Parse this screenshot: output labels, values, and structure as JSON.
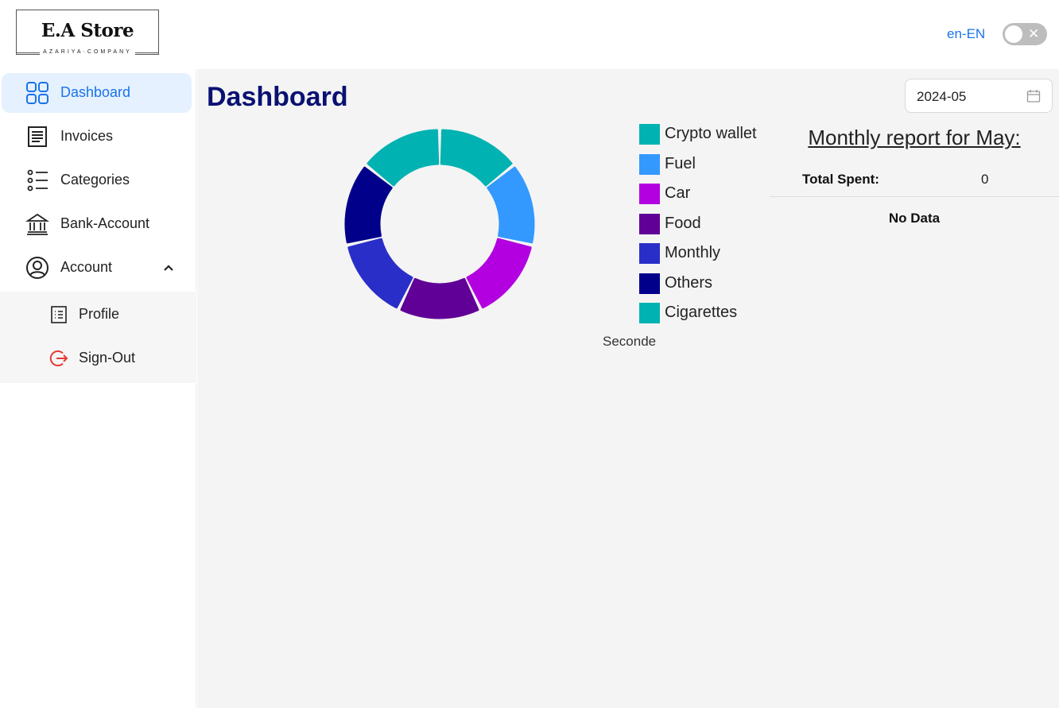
{
  "header": {
    "logo_title": "E.A Store",
    "logo_subtitle": "AZARIYA·COMPANY",
    "language": "en-EN",
    "toggle_state": "off"
  },
  "sidebar": {
    "items": [
      {
        "label": "Dashboard",
        "icon": "grid-icon",
        "active": true
      },
      {
        "label": "Invoices",
        "icon": "receipt-icon"
      },
      {
        "label": "Categories",
        "icon": "list-icon"
      },
      {
        "label": "Bank-Account",
        "icon": "bank-icon"
      },
      {
        "label": "Account",
        "icon": "user-circle-icon",
        "expanded": true
      }
    ],
    "sub_items": [
      {
        "label": "Profile",
        "icon": "profile-list-icon"
      },
      {
        "label": "Sign-Out",
        "icon": "sign-out-icon"
      }
    ]
  },
  "main": {
    "title": "Dashboard",
    "date_value": "2024-05",
    "chart_caption": "Seconde",
    "report": {
      "title": "Monthly report for May:",
      "total_label": "Total Spent:",
      "total_value": "0",
      "empty_text": "No Data"
    }
  },
  "colors": {
    "accent": "#1a73e8",
    "title": "#0a1172",
    "active_bg": "#e5f1ff",
    "sign_out": "#e53935"
  },
  "chart_data": {
    "type": "pie",
    "variant": "donut",
    "categories": [
      "Crypto wallet",
      "Fuel",
      "Car",
      "Food",
      "Monthly",
      "Others",
      "Cigarettes"
    ],
    "values": [
      1,
      1,
      1,
      1,
      1,
      1,
      1
    ],
    "colors": [
      "#00b2b2",
      "#3399ff",
      "#b300e0",
      "#600096",
      "#2a2ec9",
      "#00008b",
      "#00b2b2"
    ],
    "legend": "right",
    "caption": "Seconde"
  }
}
